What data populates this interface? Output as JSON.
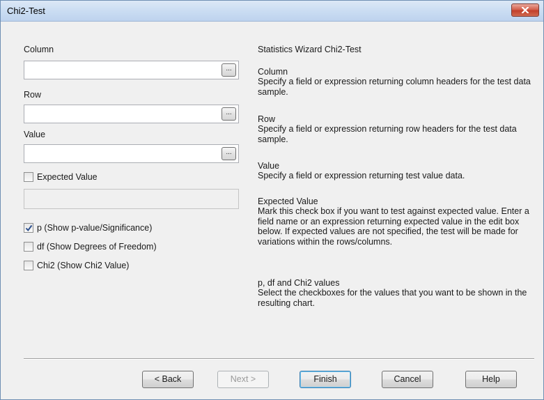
{
  "window": {
    "title": "Chi2-Test"
  },
  "form": {
    "column_label": "Column",
    "column_value": "",
    "row_label": "Row",
    "row_value": "",
    "value_label": "Value",
    "value_value": "",
    "browse_label": "...",
    "expected_label": "Expected Value",
    "expected_checked": false,
    "expected_value": "",
    "p_label": "p (Show p-value/Significance)",
    "p_checked": true,
    "df_label": "df (Show Degrees of Freedom)",
    "df_checked": false,
    "chi2_label": "Chi2 (Show Chi2 Value)",
    "chi2_checked": false
  },
  "help": {
    "heading": "Statistics Wizard Chi2-Test",
    "column_title": "Column",
    "column_text": "Specify a field or expression returning column headers for the test data sample.",
    "row_title": "Row",
    "row_text": "Specify a field or expression returning row headers for the test data sample.",
    "value_title": "Value",
    "value_text": "Specify a field or expression returning test value data.",
    "expected_title": "Expected Value",
    "expected_text": "Mark this check box if you want to test against expected value. Enter a field name or an expression returning expected value in the edit box below. If expected values are not specified, the test will be made for variations within the rows/columns.",
    "values_title": "p, df and Chi2 values",
    "values_text": "Select the checkboxes for the values that you want to be shown in the resulting chart."
  },
  "buttons": {
    "back": "< Back",
    "next": "Next >",
    "finish": "Finish",
    "cancel": "Cancel",
    "help": "Help"
  },
  "colors": {
    "titlebar": "#c9dcf2",
    "close_button": "#c2402b",
    "check_mark": "#2c4f8c"
  }
}
